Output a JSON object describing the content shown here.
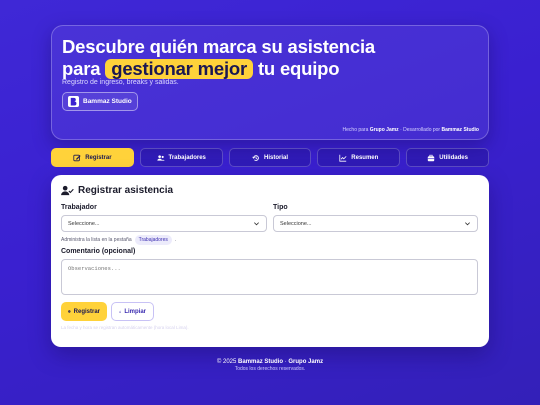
{
  "hero": {
    "title_line1": "Descubre quién marca su asistencia",
    "title_prefix": "para ",
    "title_highlight": "gestionar mejor",
    "title_suffix": " tu equipo",
    "subtitle": "Registro de ingreso, breaks y salidas.",
    "brand_name": "Bammaz Studio",
    "credits_made_by_label": "Hecho para",
    "credits_made_by": "Grupo Jamz",
    "credits_separator": " · Desarrollado por ",
    "credits_developer": "Bammaz Studio"
  },
  "tabs": [
    {
      "label": "Registrar",
      "icon": "pencil-icon",
      "active": true
    },
    {
      "label": "Trabajadores",
      "icon": "users-icon",
      "active": false
    },
    {
      "label": "Historial",
      "icon": "history-icon",
      "active": false
    },
    {
      "label": "Resumen",
      "icon": "chart-icon",
      "active": false
    },
    {
      "label": "Utilidades",
      "icon": "toolbox-icon",
      "active": false
    }
  ],
  "form": {
    "title": "Registrar asistencia",
    "worker_label": "Trabajador",
    "worker_value": "Seleccione...",
    "type_label": "Tipo",
    "type_value": "Seleccione...",
    "hint_text": "Administra la lista en la pestaña",
    "hint_chip": "Trabajadores",
    "hint_end": ".",
    "comment_label": "Comentario (opcional)",
    "comment_placeholder": "Observaciones...",
    "submit_label": "Registrar",
    "clear_label": "Limpiar",
    "note": "La fecha y hora se registran automáticamente (hora local Lima)."
  },
  "footer": {
    "copyright_prefix": "© 2025 ",
    "copyright_brand": "Bammaz Studio",
    "copyright_sep": " · ",
    "copyright_group": "Grupo Jamz",
    "rights": "Todos los derechos reservados."
  },
  "colors": {
    "background": "#3a20d0",
    "accent": "#ffd23a",
    "text_dark": "#1b1752"
  }
}
